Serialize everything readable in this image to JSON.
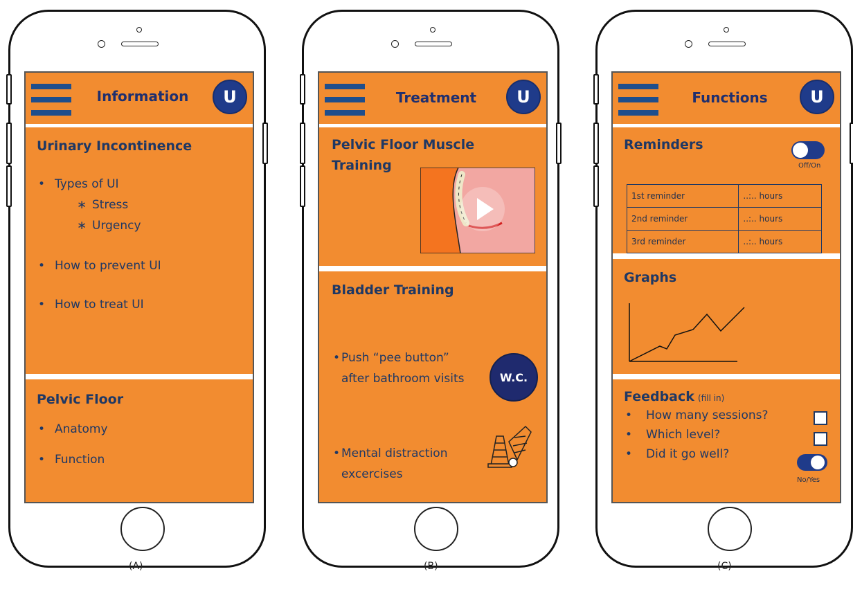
{
  "phones": [
    {
      "caption": "(A)",
      "title": "Information",
      "avatar_letter": "U",
      "sections": [
        {
          "title": "Urinary Incontinence",
          "items": [
            "Types of UI",
            "How to prevent UI",
            "How to treat UI"
          ],
          "subitems": [
            "Stress",
            "Urgency"
          ]
        },
        {
          "title": "Pelvic Floor",
          "items": [
            "Anatomy",
            "Function"
          ]
        }
      ]
    },
    {
      "caption": "(B)",
      "title": "Treatment",
      "avatar_letter": "U",
      "sections": [
        {
          "title": "Pelvic Floor Muscle Training"
        },
        {
          "title": "Bladder Training",
          "items": [
            "Push “pee button” after bathroom visits",
            "Mental distraction excercises"
          ],
          "wc_label": "W.C."
        }
      ]
    },
    {
      "caption": "(C)",
      "title": "Functions",
      "avatar_letter": "U",
      "reminders": {
        "title": "Reminders",
        "toggle_label": "Off/On",
        "rows": [
          [
            "1st reminder",
            "..:.. hours"
          ],
          [
            "2nd reminder",
            "..:.. hours"
          ],
          [
            "3rd reminder",
            "..:.. hours"
          ]
        ]
      },
      "graphs": {
        "title": "Graphs"
      },
      "feedback": {
        "title": "Feedback",
        "title_note": "(fill in)",
        "items": [
          "How many sessions?",
          "Which level?",
          "Did it go well?"
        ],
        "toggle_label": "No/Yes"
      }
    }
  ],
  "colors": {
    "accent": "#f28c30",
    "navy": "#1f3864",
    "avatar": "#1f3b8a"
  },
  "icons": [
    "hamburger-menu-icon",
    "user-avatar-icon",
    "play-icon",
    "wc-button-icon",
    "traffic-cones-icon",
    "line-graph-icon"
  ]
}
